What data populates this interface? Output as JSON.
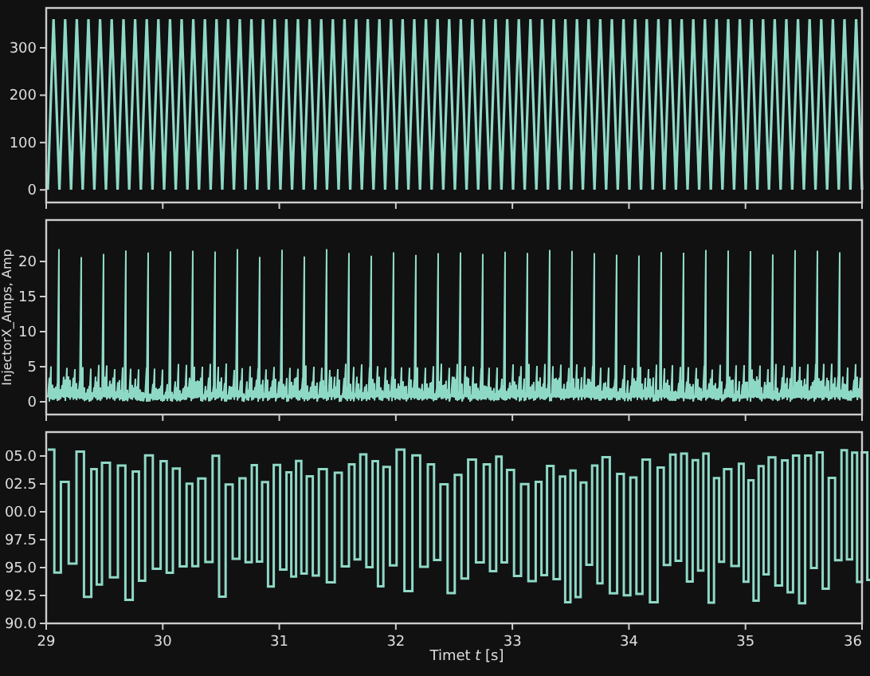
{
  "panels": [
    {
      "kind": "sawtooth",
      "yticks": [
        "300",
        "200",
        "100",
        "0"
      ]
    },
    {
      "kind": "spikes",
      "ylabel": "InjectorX_Amps, Amp",
      "yticks": [
        "20",
        "15",
        "10",
        "5",
        "0"
      ]
    },
    {
      "kind": "square",
      "yticks": [
        "05.0",
        "02.5",
        "00.0",
        "97.5",
        "95.0",
        "92.5",
        "90.0"
      ],
      "xticks": [
        "29",
        "30",
        "31",
        "32",
        "33",
        "34",
        "35",
        "36"
      ]
    }
  ],
  "xlabel": "Timet *t* [s]"
}
